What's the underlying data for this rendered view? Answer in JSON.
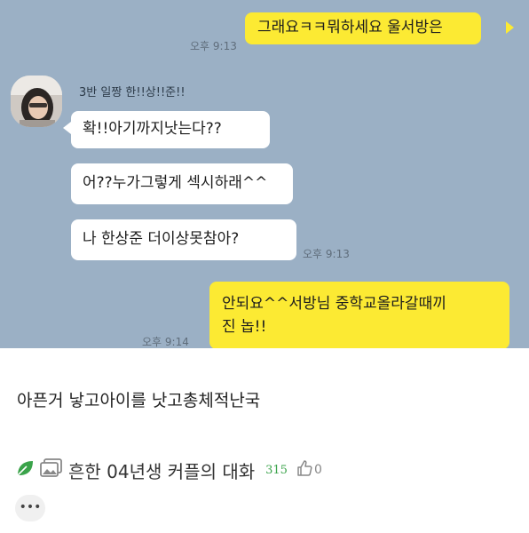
{
  "chat": {
    "messages": [
      {
        "text": "그래요ㅋㅋ뭐하세요 울서방은"
      },
      {
        "text": "확!!아기까지낫는다??"
      },
      {
        "text": "어??누가그렇게 섹시하래^^"
      },
      {
        "text": "나 한상준 더이상못참아?"
      },
      {
        "text": "안되요^^서방님 중학교올라갈때끼"
      },
      {
        "text": "진 놉!!"
      }
    ],
    "times": [
      "오후 9:13",
      "오후 9:13",
      "오후 9:14"
    ],
    "sender_name": "3반 일짱 한!!상!!준!!"
  },
  "caption": "아픈거 낳고아이를 낫고총체적난국",
  "meta": {
    "title": "흔한 04년생 커플의 대화",
    "views": "315",
    "likes": "0",
    "more_label": "•••"
  },
  "colors": {
    "chat_bg": "#9bb0c5",
    "my_bubble": "#fcea33",
    "other_bubble": "#ffffff",
    "views_green": "#3aa34a"
  },
  "icons": [
    "leaf-icon",
    "image-icon",
    "thumbs-up-icon",
    "more-icon",
    "avatar-image"
  ]
}
